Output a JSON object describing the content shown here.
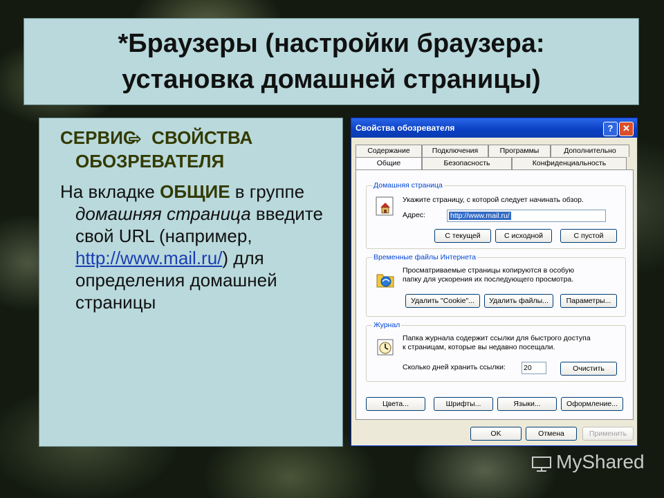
{
  "slide": {
    "title_line1": "*Браузеры (настройки браузера:",
    "title_line2": "установка домашней страницы)",
    "menu_part1": "СЕРВИС",
    "menu_part2": "СВОЙСТВА ОБОЗРЕВАТЕЛЯ",
    "p_a": "На вкладке ",
    "p_b": "ОБЩИЕ",
    "p_c": " в группе ",
    "p_d": "домашняя страница",
    "p_e": " введите свой URL (например, ",
    "p_link": "http://www.mail.ru/",
    "p_f": ") для определения домашней страницы",
    "watermark": "MyShared"
  },
  "dialog": {
    "title": "Свойства обозревателя",
    "help": "?",
    "close": "✕",
    "tabs_row1": [
      "Содержание",
      "Подключения",
      "Программы",
      "Дополнительно"
    ],
    "tabs_row2": [
      "Общие",
      "Безопасность",
      "Конфиденциальность"
    ],
    "home": {
      "label": "Домашняя страница",
      "desc": "Укажите страницу, с которой следует начинать обзор.",
      "addr_label": "Адрес:",
      "addr_value": "http://www.mail.ru/",
      "btn_current": "С текущей",
      "btn_default": "С исходной",
      "btn_blank": "С пустой"
    },
    "temp": {
      "label": "Временные файлы Интернета",
      "desc1": "Просматриваемые страницы копируются в особую",
      "desc2": "папку для ускорения их последующего просмотра.",
      "btn_cookie": "Удалить \"Cookie\"...",
      "btn_files": "Удалить файлы...",
      "btn_params": "Параметры..."
    },
    "history": {
      "label": "Журнал",
      "desc1": "Папка журнала содержит ссылки для быстрого доступа",
      "desc2": "к страницам, которые вы недавно посещали.",
      "days_label": "Сколько дней хранить ссылки:",
      "days_value": "20",
      "btn_clear": "Очистить"
    },
    "bottom": {
      "colors": "Цвета...",
      "fonts": "Шрифты...",
      "langs": "Языки...",
      "design": "Оформление..."
    },
    "ok": "OK",
    "cancel": "Отмена",
    "apply": "Применить"
  }
}
